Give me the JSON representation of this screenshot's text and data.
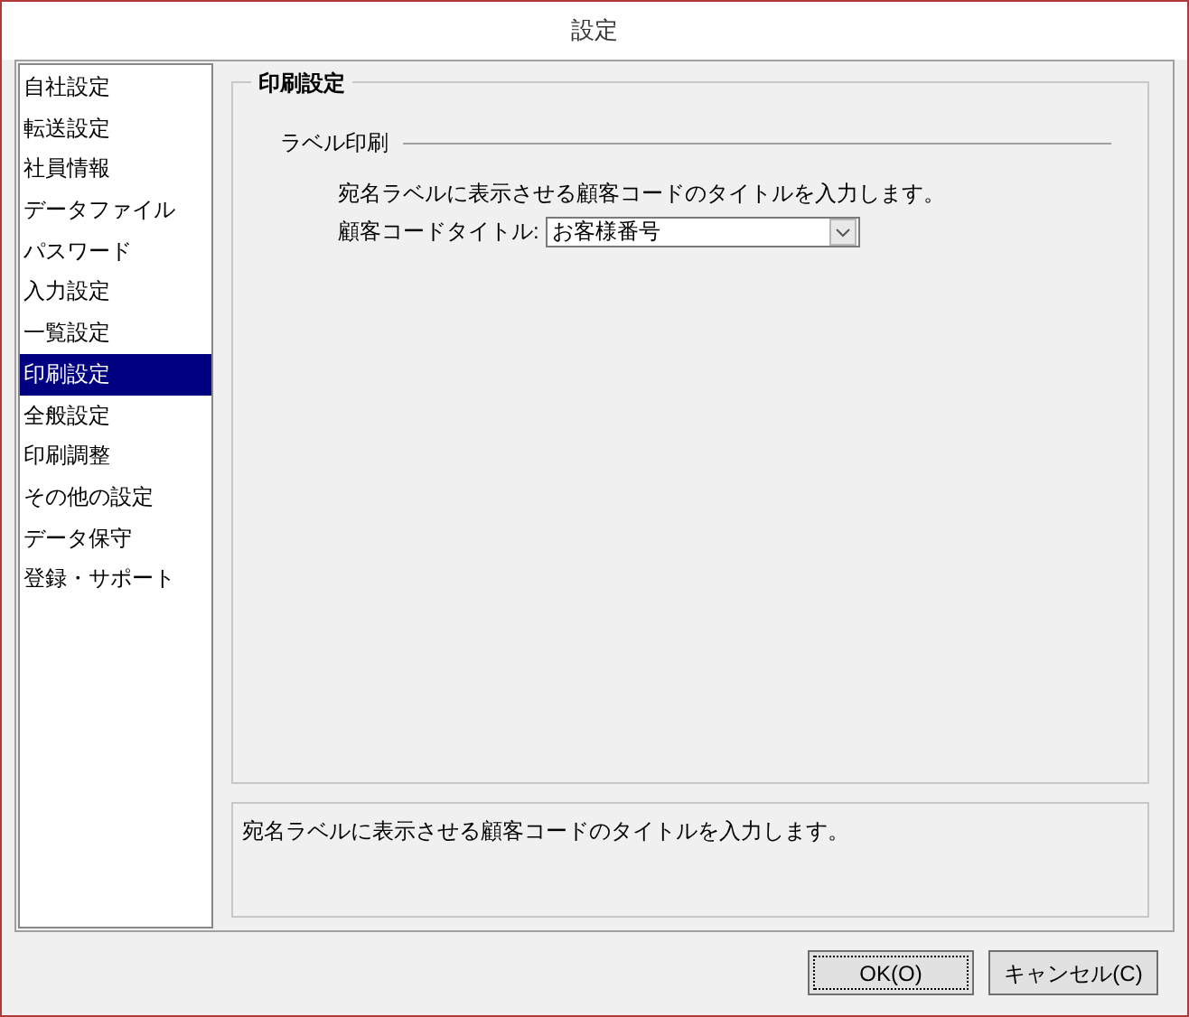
{
  "window": {
    "title": "設定"
  },
  "sidebar": {
    "items": [
      {
        "label": "自社設定",
        "selected": false
      },
      {
        "label": "転送設定",
        "selected": false
      },
      {
        "label": "社員情報",
        "selected": false
      },
      {
        "label": "データファイル",
        "selected": false
      },
      {
        "label": "パスワード",
        "selected": false
      },
      {
        "label": "入力設定",
        "selected": false
      },
      {
        "label": "一覧設定",
        "selected": false
      },
      {
        "label": "印刷設定",
        "selected": true
      },
      {
        "label": "全般設定",
        "selected": false
      },
      {
        "label": "印刷調整",
        "selected": false
      },
      {
        "label": "その他の設定",
        "selected": false
      },
      {
        "label": "データ保守",
        "selected": false
      },
      {
        "label": "登録・サポート",
        "selected": false
      }
    ]
  },
  "group": {
    "title": "印刷設定",
    "section": "ラベル印刷",
    "instruction": "宛名ラベルに表示させる顧客コードのタイトルを入力します。",
    "field_label": "顧客コードタイトル:",
    "field_value": "お客様番号"
  },
  "description": "宛名ラベルに表示させる顧客コードのタイトルを入力します。",
  "buttons": [
    {
      "label": "OK(O)",
      "focused": true
    },
    {
      "label": "キャンセル(C)",
      "focused": false
    }
  ]
}
